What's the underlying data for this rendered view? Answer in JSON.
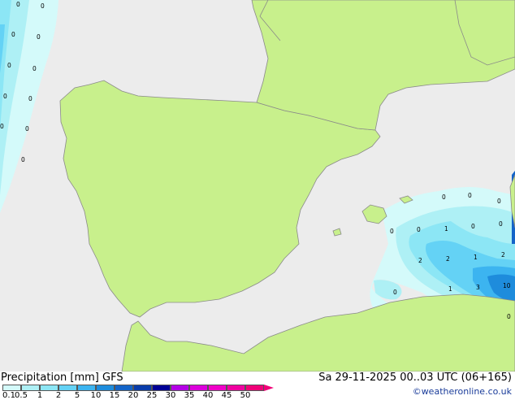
{
  "legend": {
    "title": "Precipitation [mm]  GFS",
    "levels": [
      "0.1",
      "0.5",
      "1",
      "2",
      "5",
      "10",
      "15",
      "20",
      "25",
      "30",
      "35",
      "40",
      "45",
      "50"
    ],
    "colors": [
      "#d4fafa",
      "#aef0f5",
      "#8ce6f5",
      "#64d2f5",
      "#3cb4f0",
      "#1e8cdc",
      "#1464c8",
      "#0a3caa",
      "#000096",
      "#b400e6",
      "#dc00dc",
      "#f000c8",
      "#f000a0",
      "#f00078"
    ]
  },
  "forecast_time": "Sa 29-11-2025 00..03 UTC (06+165)",
  "credit": "©weatheronline.co.uk",
  "map": {
    "land_color": "#c8f08c",
    "sea_color": "#ececec",
    "coast_color": "#8a8a8a",
    "values": [
      "0",
      "0",
      "0",
      "0",
      "0",
      "0",
      "0",
      "0",
      "0",
      "0",
      "0",
      "0",
      "0",
      "0",
      "0",
      "1",
      "0",
      "0",
      "2",
      "2",
      "1",
      "2",
      "1",
      "3",
      "10",
      "0",
      "0",
      "0"
    ]
  }
}
